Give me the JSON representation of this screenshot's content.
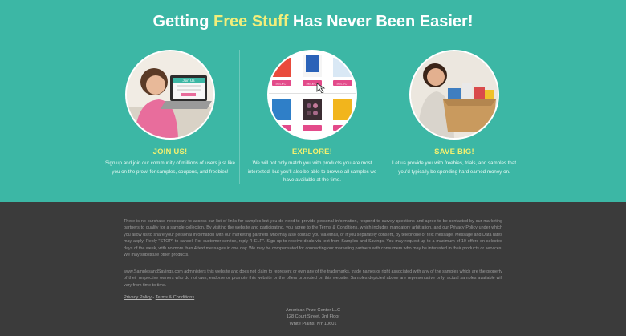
{
  "hero": {
    "headline_pre": "Getting ",
    "headline_accent": "Free Stuff",
    "headline_post": " Has Never Been Easier!",
    "colors": {
      "background": "#3cb7a5",
      "accent": "#f2ee7a",
      "heading": "#f3f06f"
    },
    "columns": [
      {
        "image": "woman-laptop-join-us-image",
        "image_caption": "Join Us",
        "title": "JOIN US!",
        "text": "Sign up and join our community of millions of users just like you on the prowl for samples, coupons, and freebies!"
      },
      {
        "image": "product-grid-select-image",
        "select_label": "SELECT",
        "title": "EXPLORE!",
        "text": "We will not only match you with products you are most interested, but you'll also be able to browse all samples we have available at the time."
      },
      {
        "image": "woman-box-of-products-image",
        "title": "SAVE BIG!",
        "text": "Let us provide you with freebies, trials, and samples that you'd typically be spending hard earned money on."
      }
    ]
  },
  "footer": {
    "legal1": "There is no purchase necessary to access our list of links for samples but you do need to provide personal information, respond to survey questions and agree to be contacted by our marketing partners to qualify for a sample collection. By visiting the website and participating, you agree to the Terms & Conditions, which includes mandatory arbitration, and our Privacy Policy under which you allow us to share your personal information with our marketing partners who may also contact you via email, or if you separately consent, by telephone or text message. Message and Data rates may apply. Reply \"STOP\" to cancel. For customer service, reply \"HELP\". Sign up to receive deals via text from Samples and Savings. You may request up to a maximum of 10 offers on selected days of the week, with no more than 4 text messages in one day. We may be compensated for connecting our marketing partners with consumers who may be interested in their products or services. We may substitute other products.",
    "legal2": "www.SamplesandSavings.com administers this website and does not claim to represent or own any of the trademarks, trade names or right associated with any of the samples which are the property of their respective owners who do not own, endorse or promote this website or the offers promoted on this website. Samples depicted above are representative only; actual samples available will vary from time to time.",
    "privacy_link": "Privacy Policy",
    "separator": " - ",
    "terms_link": "Terms & Conditions",
    "address_line1": "American Prize Center LLC",
    "address_line2": "128 Court Street, 3rd Floor",
    "address_line3": "White Plains, NY 10601"
  }
}
